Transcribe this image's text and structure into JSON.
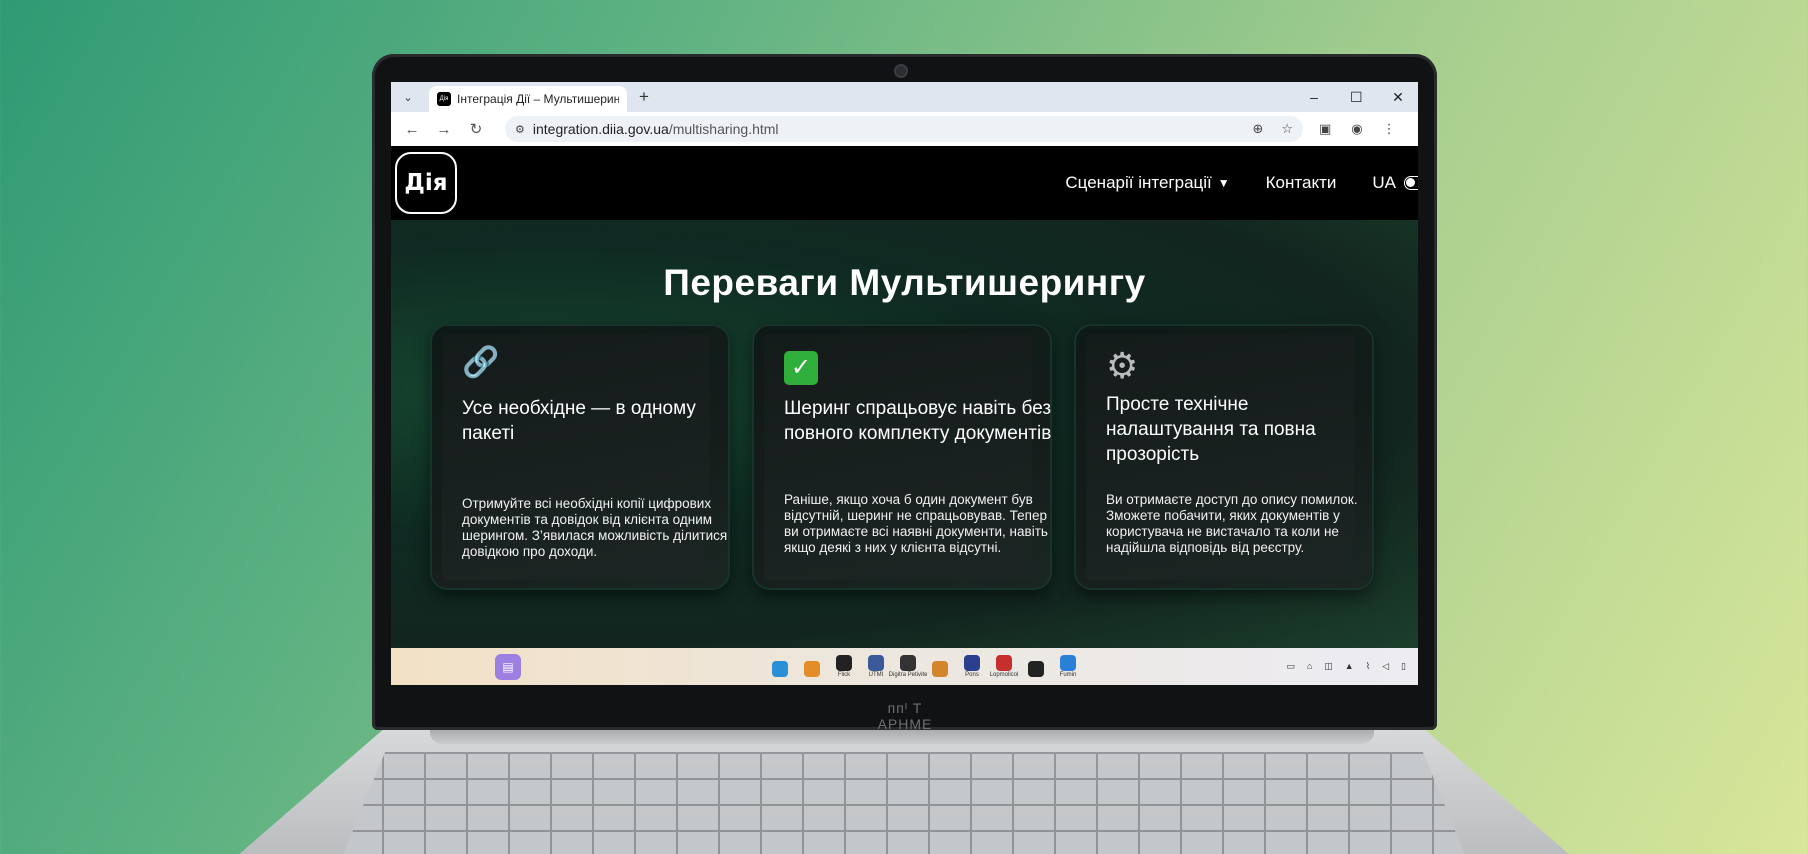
{
  "browser": {
    "tab_title": "Інтеграція Дії – Мультишеринг",
    "favicon_text": "Дія",
    "new_tab": "+",
    "url_host": "integration.diia.gov.ua",
    "url_path": "/multisharing.html",
    "icons": {
      "tab_menu": "chevron-down-icon",
      "back": "arrow-left-icon",
      "forward": "arrow-right-icon",
      "reload": "reload-icon",
      "site_info": "tune-icon",
      "zoom": "zoom-icon",
      "bookmark": "star-icon",
      "extensions": "puzzle-icon",
      "profile": "profile-icon",
      "menu": "kebab-menu-icon",
      "minimize": "minimize-icon",
      "maximize": "maximize-icon",
      "close": "close-icon"
    }
  },
  "site": {
    "logo": "Дія",
    "nav": {
      "scenarios": "Сценарії інтеграції",
      "contacts": "Контакти",
      "lang": "UA"
    }
  },
  "main": {
    "title": "Переваги Мультишерингу",
    "cards": [
      {
        "icon": "link-icon",
        "heading": "Усе необхідне — в одному пакеті",
        "body": "Отримуйте всі необхідні копії цифрових документів та довідок від клієнта одним шерингом. З’явилася можливість ділитися довідкою про доходи."
      },
      {
        "icon": "check-icon",
        "heading": "Шеринг спрацьовує навіть без повного комплекту документів",
        "body": "Раніше, якщо хоча б один документ був відсутній, шеринг не спрацьовував. Тепер ви отримаєте всі наявні документи, навіть якщо деякі з них у клієнта відсутні."
      },
      {
        "icon": "gear-icon",
        "heading": "Просте технічне налаштування та повна прозорість",
        "body": "Ви отримаєте доступ до опису помилок. Зможете побачити, яких документів у користувача не вистачало та коли не надійшла відповідь від реєстру."
      }
    ]
  },
  "taskbar": {
    "apps": [
      {
        "label": "",
        "color": "#2a8fd6"
      },
      {
        "label": "",
        "color": "#e48b2a"
      },
      {
        "label": "Flick",
        "color": "#222222"
      },
      {
        "label": "UTMI",
        "color": "#3b5998"
      },
      {
        "label": "Digitra Petivite",
        "color": "#333333"
      },
      {
        "label": "",
        "color": "#d1862d"
      },
      {
        "label": "Pons",
        "color": "#2b3f8f"
      },
      {
        "label": "Lopmolicol",
        "color": "#c72f2f"
      },
      {
        "label": "",
        "color": "#222222"
      },
      {
        "label": "Fumin",
        "color": "#2a7fd6"
      }
    ]
  },
  "laptop": {
    "brand": "ᴨᴨᴵ T APHME"
  }
}
